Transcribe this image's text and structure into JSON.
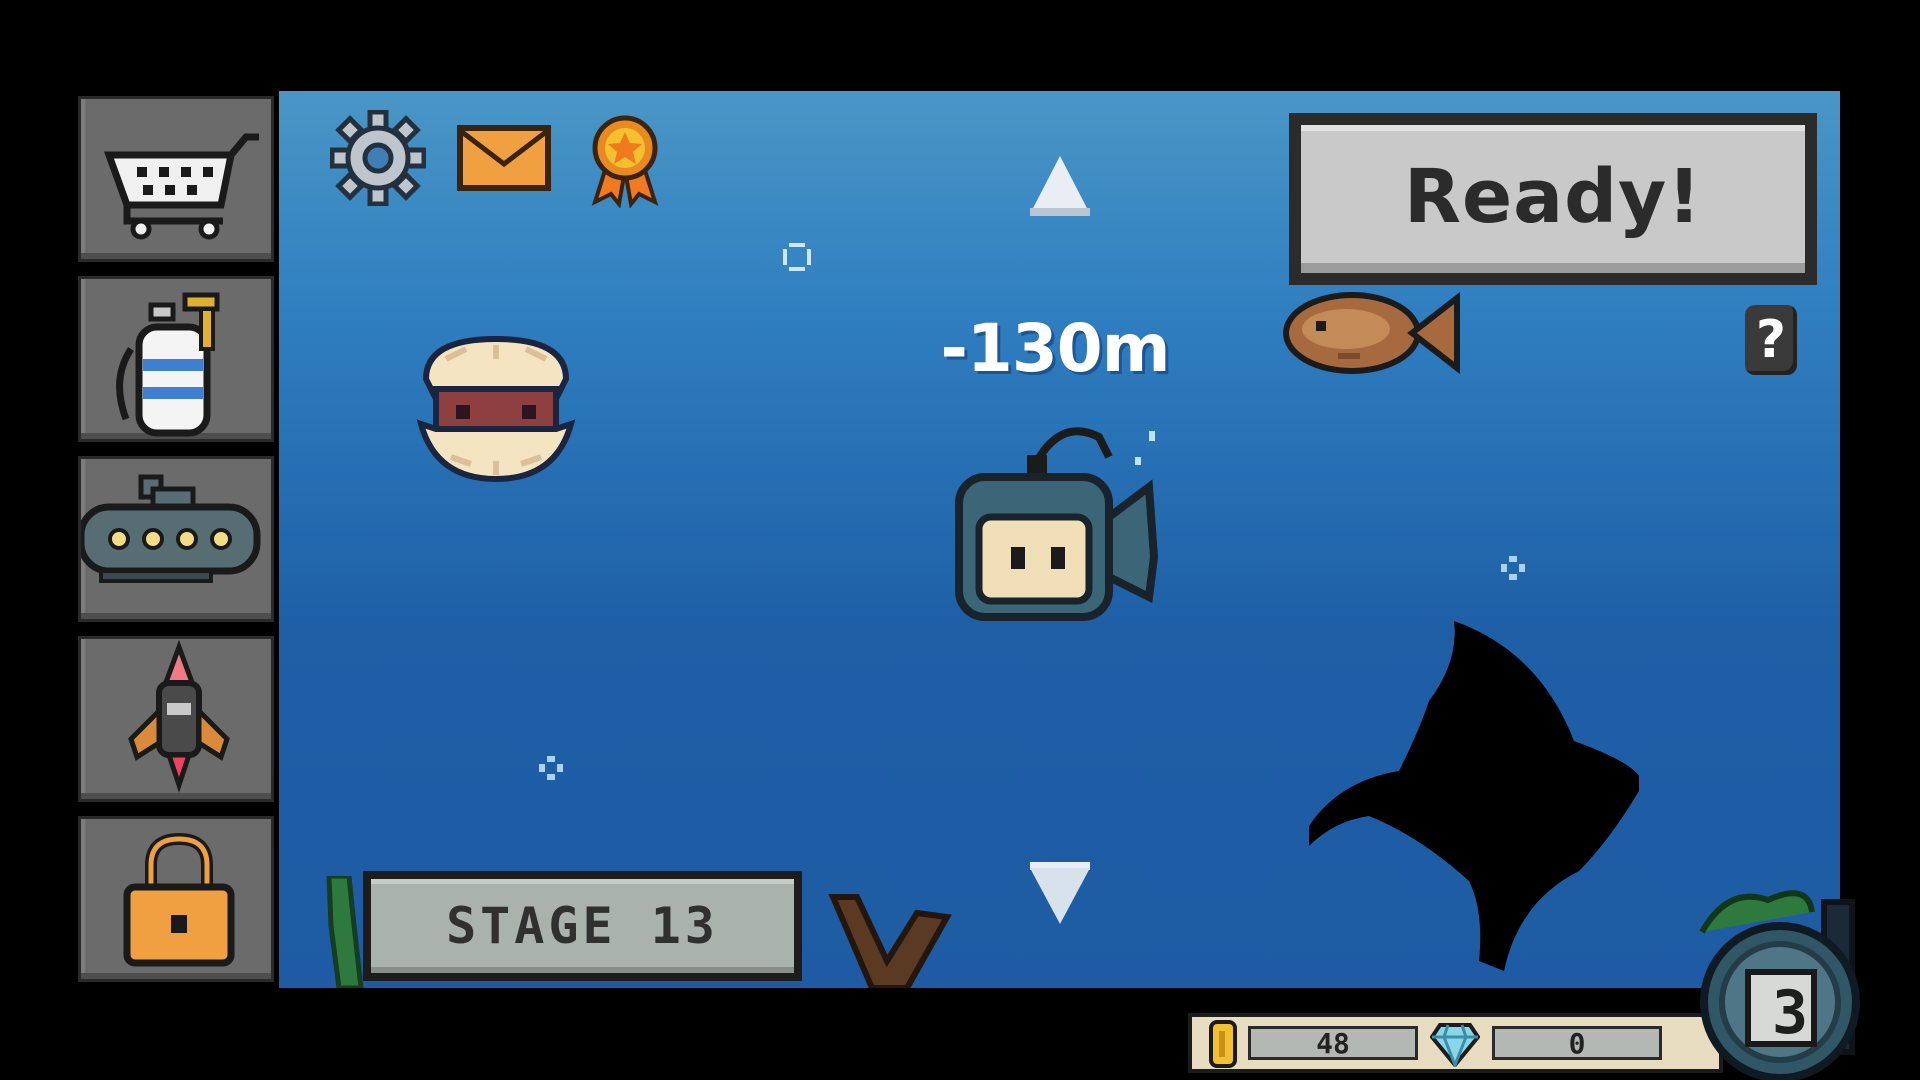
{
  "sidebar": {
    "items": [
      {
        "name": "shop",
        "icon": "shopping-cart-icon"
      },
      {
        "name": "oxygen-tank",
        "icon": "oxygen-tank-icon"
      },
      {
        "name": "submarine",
        "icon": "submarine-icon"
      },
      {
        "name": "rocket",
        "icon": "rocket-icon"
      },
      {
        "name": "locked",
        "icon": "padlock-icon"
      }
    ]
  },
  "top_icons": [
    "gear-icon",
    "mail-icon",
    "medal-icon"
  ],
  "ready_button": {
    "label": "Ready!"
  },
  "help_button": {
    "label": "?"
  },
  "depth": {
    "label": "-130m"
  },
  "stage": {
    "label": "STAGE 13"
  },
  "currency": {
    "coins": "48",
    "gems": "0"
  },
  "timer": {
    "value": "3"
  },
  "colors": {
    "sea_top": "#4a96c6",
    "sea_bottom": "#1e5ba4",
    "button_gray": "#c9c9c9",
    "sidebar_gray": "#6b6b6b",
    "envelope_orange": "#f0a040"
  }
}
